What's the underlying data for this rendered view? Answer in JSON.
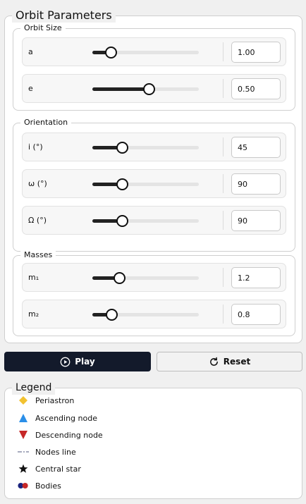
{
  "orbit_parameters": {
    "title": "Orbit Parameters",
    "orbit_size": {
      "title": "Orbit Size",
      "rows": [
        {
          "label": "a",
          "value": "1.00",
          "slider_fraction": 0.17
        },
        {
          "label": "e",
          "value": "0.50",
          "slider_fraction": 0.53
        }
      ]
    },
    "orientation": {
      "title": "Orientation",
      "rows": [
        {
          "label": "i (°)",
          "value": "45",
          "slider_fraction": 0.28
        },
        {
          "label": "ω (°)",
          "value": "90",
          "slider_fraction": 0.28
        },
        {
          "label": "Ω (°)",
          "value": "90",
          "slider_fraction": 0.28
        }
      ]
    },
    "masses": {
      "title": "Masses",
      "rows": [
        {
          "label": "m₁",
          "value": "1.2",
          "slider_fraction": 0.25
        },
        {
          "label": "m₂",
          "value": "0.8",
          "slider_fraction": 0.18
        }
      ]
    }
  },
  "controls": {
    "play_label": "Play",
    "reset_label": "Reset"
  },
  "legend": {
    "title": "Legend",
    "items": [
      {
        "label": "Periastron",
        "icon": "yellow-diamond-icon",
        "color": "#f2c230"
      },
      {
        "label": "Ascending node",
        "icon": "blue-triangle-up-icon",
        "color": "#2b8fe8"
      },
      {
        "label": "Descending node",
        "icon": "red-triangle-down-icon",
        "color": "#c62828"
      },
      {
        "label": "Nodes line",
        "icon": "dashed-line-icon",
        "color": "#8a8fa8"
      },
      {
        "label": "Central star",
        "icon": "star-icon",
        "color": "#111111"
      },
      {
        "label": "Bodies",
        "icon": "bodies-dots-icon",
        "color": "#1a237e"
      }
    ]
  },
  "colors": {
    "accent_dark": "#131a2b",
    "slider_fill": "#222222",
    "body1": "#1a237e",
    "body2": "#c62828"
  }
}
